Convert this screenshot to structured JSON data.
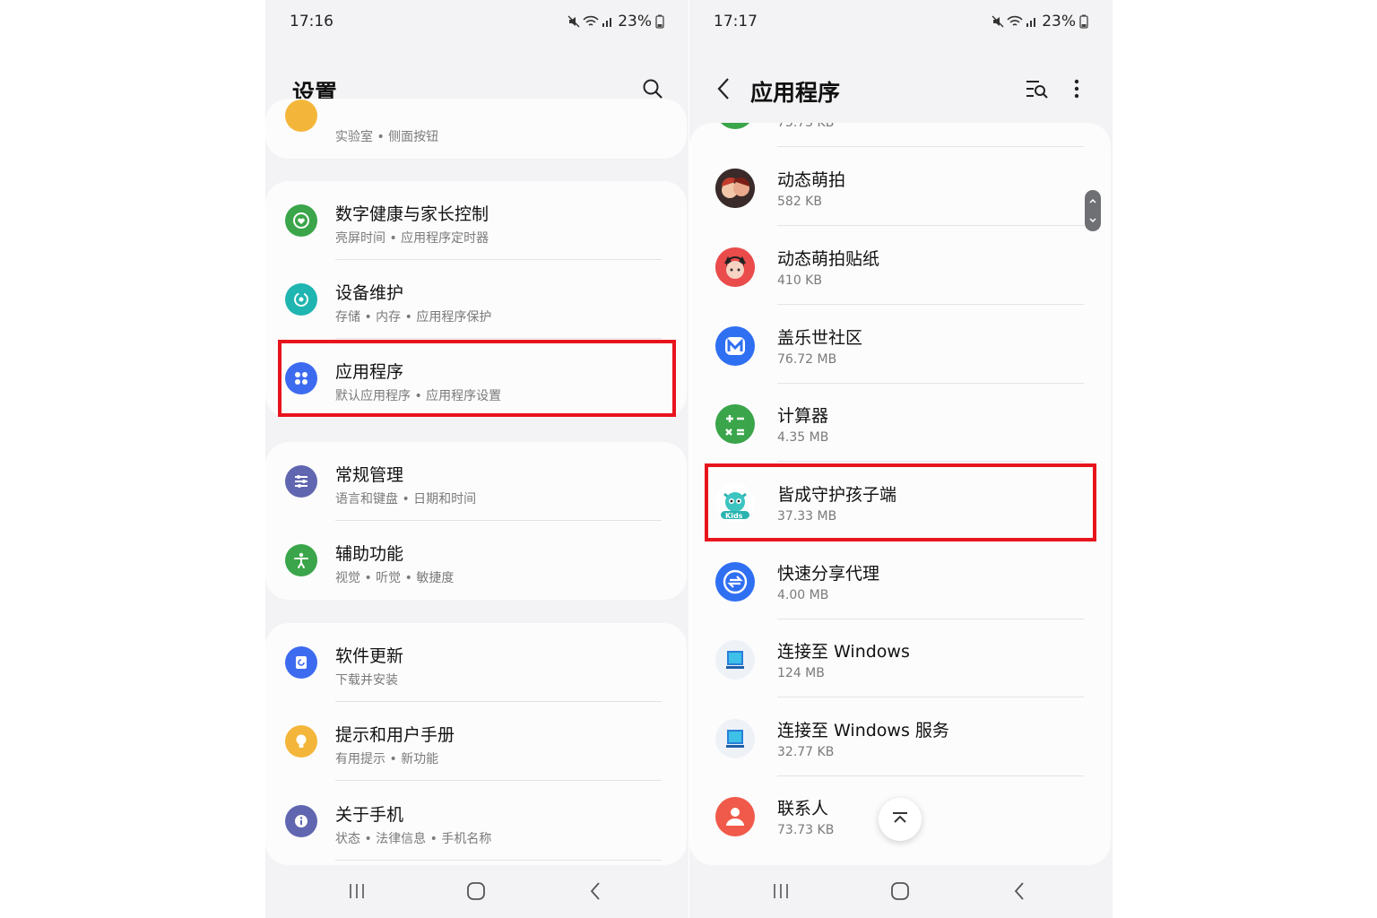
{
  "left": {
    "status": {
      "time": "17:16",
      "battery": "23%"
    },
    "title": "设置",
    "partial_row": {
      "sub": "实验室 • 侧面按钮"
    },
    "rows": [
      {
        "title": "数字健康与家长控制",
        "sub": "亮屏时间 • 应用程序定时器",
        "icon": "digital-wellbeing-icon",
        "color": "#3aa54a"
      },
      {
        "title": "设备维护",
        "sub": "存储 • 内存 • 应用程序保护",
        "icon": "device-care-icon",
        "color": "#1fb5b0"
      },
      {
        "title": "应用程序",
        "sub": "默认应用程序 • 应用程序设置",
        "icon": "apps-icon",
        "color": "#3d6bf0"
      },
      {
        "title": "常规管理",
        "sub": "语言和键盘 • 日期和时间",
        "icon": "general-management-icon",
        "color": "#6166b0"
      },
      {
        "title": "辅助功能",
        "sub": "视觉 • 听觉 • 敏捷度",
        "icon": "accessibility-icon",
        "color": "#3aa54a"
      },
      {
        "title": "软件更新",
        "sub": "下载并安装",
        "icon": "software-update-icon",
        "color": "#3d6bf0"
      },
      {
        "title": "提示和用户手册",
        "sub": "有用提示 • 新功能",
        "icon": "tips-icon",
        "color": "#f4b63a"
      },
      {
        "title": "关于手机",
        "sub": "状态 • 法律信息 • 手机名称",
        "icon": "about-phone-icon",
        "color": "#6166b0"
      }
    ]
  },
  "right": {
    "status": {
      "time": "17:17",
      "battery": "23%"
    },
    "title": "应用程序",
    "partial_row": {
      "sub": "73.73 KB"
    },
    "apps": [
      {
        "title": "动态萌拍",
        "sub": "582 KB",
        "icon": "ar-emoji-icon"
      },
      {
        "title": "动态萌拍贴纸",
        "sub": "410 KB",
        "icon": "ar-emoji-stickers-icon"
      },
      {
        "title": "盖乐世社区",
        "sub": "76.72 MB",
        "icon": "galaxy-members-icon"
      },
      {
        "title": "计算器",
        "sub": "4.35 MB",
        "icon": "calculator-icon"
      },
      {
        "title": "皆成守护孩子端",
        "sub": "37.33 MB",
        "icon": "kids-guard-icon",
        "icon_label": "Kids"
      },
      {
        "title": "快速分享代理",
        "sub": "4.00 MB",
        "icon": "quick-share-icon"
      },
      {
        "title": "连接至 Windows",
        "sub": "124 MB",
        "icon": "link-to-windows-icon"
      },
      {
        "title": "连接至 Windows 服务",
        "sub": "32.77 KB",
        "icon": "link-to-windows-service-icon"
      },
      {
        "title": "联系人",
        "sub": "73.73 KB",
        "icon": "contacts-icon"
      }
    ]
  },
  "colors": {
    "highlight": "#e8141c",
    "background": "#f3f3f5",
    "card": "#fcfcfd"
  }
}
